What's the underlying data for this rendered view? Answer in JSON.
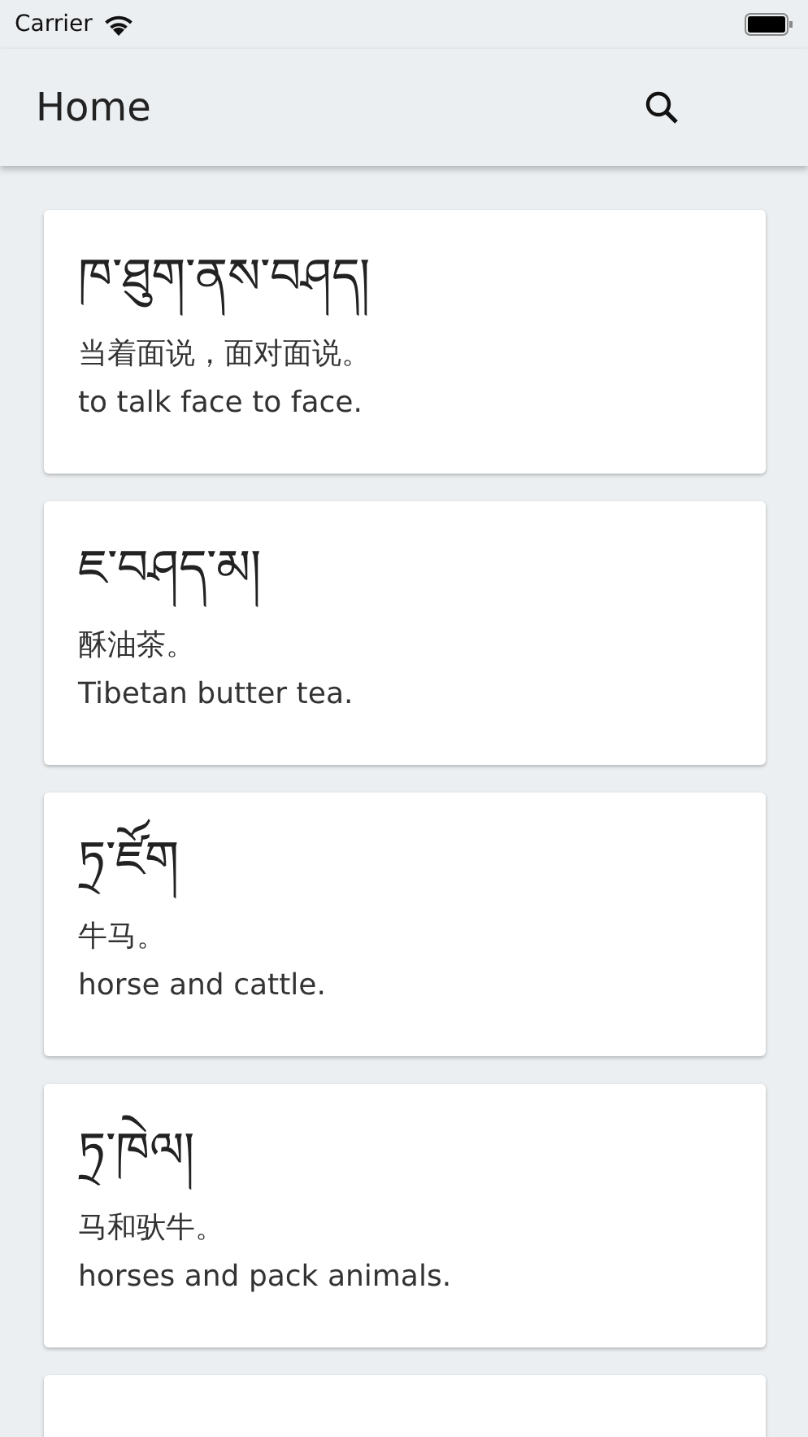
{
  "status_bar": {
    "carrier": "Carrier"
  },
  "app_bar": {
    "title": "Home"
  },
  "entries": [
    {
      "tibetan": "ཁ་ཐུག་ནས་བཤད།",
      "chinese": "当着面说，面对面说。",
      "english": "to talk face to face."
    },
    {
      "tibetan": "ཇ་བཤད་མ།",
      "chinese": "酥油茶。",
      "english": "Tibetan butter tea."
    },
    {
      "tibetan": "ཏྲ་ཛོག",
      "chinese": "牛马。",
      "english": "horse and cattle."
    },
    {
      "tibetan": "ཏྲ་ཁེལ།",
      "chinese": "马和驮牛。",
      "english": "horses and pack animals."
    }
  ],
  "more_below": true
}
